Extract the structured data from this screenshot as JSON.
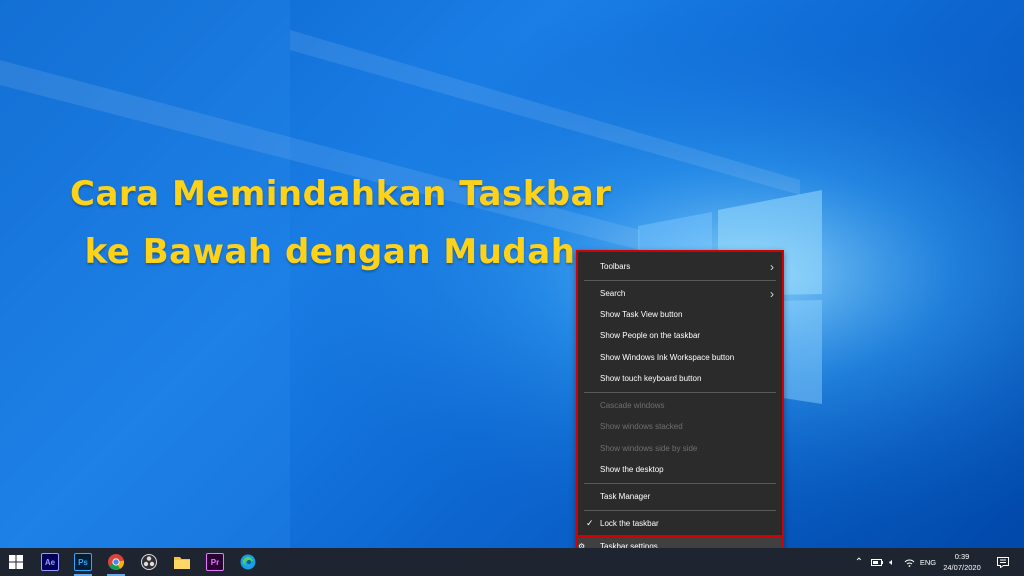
{
  "headline": {
    "line1": "Cara Memindahkan Taskbar",
    "line2": "ke Bawah dengan Mudah"
  },
  "context_menu": {
    "items": [
      {
        "label": "Toolbars",
        "submenu": true,
        "enabled": true
      },
      {
        "label": "Search",
        "submenu": true,
        "enabled": true
      },
      {
        "label": "Show Task View button",
        "enabled": true
      },
      {
        "label": "Show People on the taskbar",
        "enabled": true
      },
      {
        "label": "Show Windows Ink Workspace button",
        "enabled": true
      },
      {
        "label": "Show touch keyboard button",
        "enabled": true
      },
      {
        "label": "Cascade windows",
        "enabled": false
      },
      {
        "label": "Show windows stacked",
        "enabled": false
      },
      {
        "label": "Show windows side by side",
        "enabled": false
      },
      {
        "label": "Show the desktop",
        "enabled": true
      },
      {
        "label": "Task Manager",
        "enabled": true
      },
      {
        "label": "Lock the taskbar",
        "enabled": true,
        "checked": true
      },
      {
        "label": "Taskbar settings",
        "enabled": true,
        "icon": "gear-icon"
      }
    ]
  },
  "taskbar": {
    "apps": [
      {
        "name": "after-effects-icon",
        "abbr": "Ae",
        "color": "#9999ff"
      },
      {
        "name": "photoshop-icon",
        "abbr": "Ps",
        "color": "#31a8ff"
      },
      {
        "name": "chrome-icon"
      },
      {
        "name": "obs-icon"
      },
      {
        "name": "file-explorer-icon"
      },
      {
        "name": "premiere-icon",
        "abbr": "Pr",
        "color": "#ea77ff"
      },
      {
        "name": "edge-icon"
      }
    ],
    "tray": {
      "language": "ENG",
      "time": "0:39",
      "date": "24/07/2020"
    }
  }
}
